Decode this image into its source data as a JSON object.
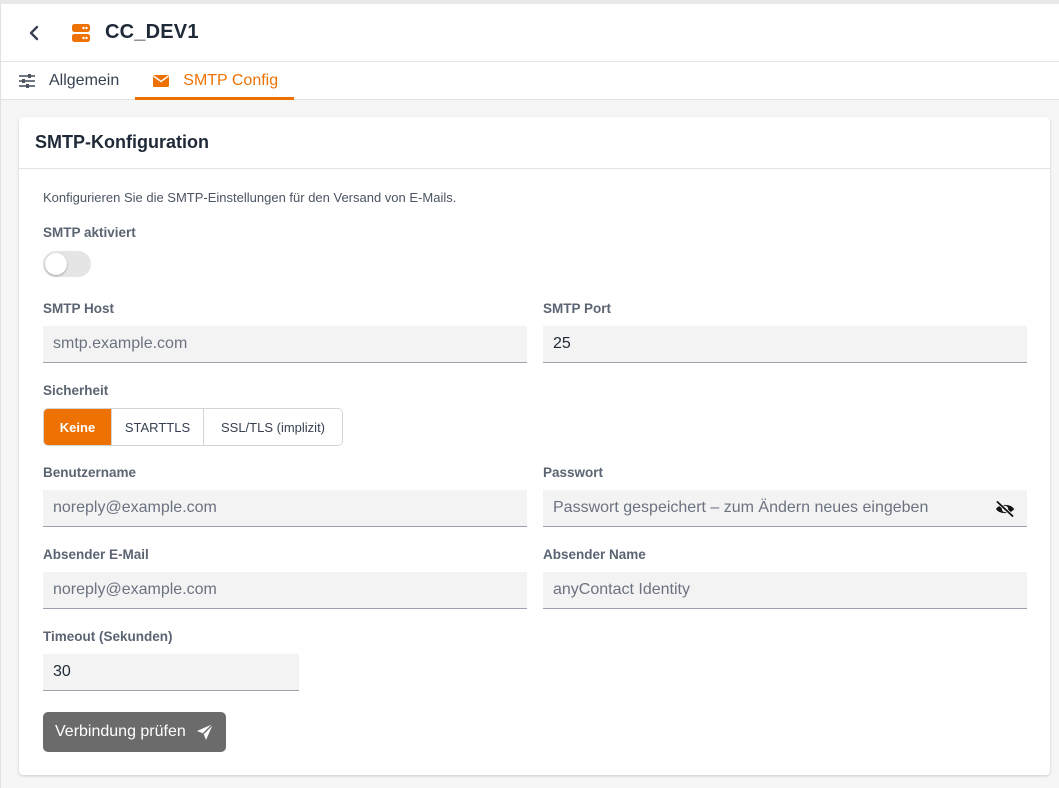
{
  "header": {
    "title": "CC_DEV1",
    "back_icon": "chevron-left-icon",
    "server_icon": "server-icon",
    "accent_color": "#ee7203"
  },
  "tabs": [
    {
      "label": "Allgemein",
      "icon": "sliders-icon",
      "active": false
    },
    {
      "label": "SMTP Config",
      "icon": "envelope-icon",
      "active": true
    }
  ],
  "card": {
    "title": "SMTP-Konfiguration",
    "description": "Konfigurieren Sie die SMTP-Einstellungen für den Versand von E-Mails."
  },
  "form": {
    "smtp_enabled": {
      "label": "SMTP aktiviert",
      "value": false
    },
    "host": {
      "label": "SMTP Host",
      "value": "",
      "placeholder": "smtp.example.com"
    },
    "port": {
      "label": "SMTP Port",
      "value": "25"
    },
    "security": {
      "label": "Sicherheit",
      "options": [
        "Keine",
        "STARTTLS",
        "SSL/TLS (implizit)"
      ],
      "selected": "Keine"
    },
    "username": {
      "label": "Benutzername",
      "value": "",
      "placeholder": "noreply@example.com"
    },
    "password": {
      "label": "Passwort",
      "value": "",
      "placeholder": "Passwort gespeichert – zum Ändern neues eingeben",
      "icon": "eye-off-icon"
    },
    "sender_email": {
      "label": "Absender E-Mail",
      "value": "",
      "placeholder": "noreply@example.com"
    },
    "sender_name": {
      "label": "Absender Name",
      "value": "",
      "placeholder": "anyContact Identity"
    },
    "timeout": {
      "label": "Timeout (Sekunden)",
      "value": "30"
    },
    "test_button": {
      "label": "Verbindung prüfen",
      "icon": "send-icon"
    }
  }
}
